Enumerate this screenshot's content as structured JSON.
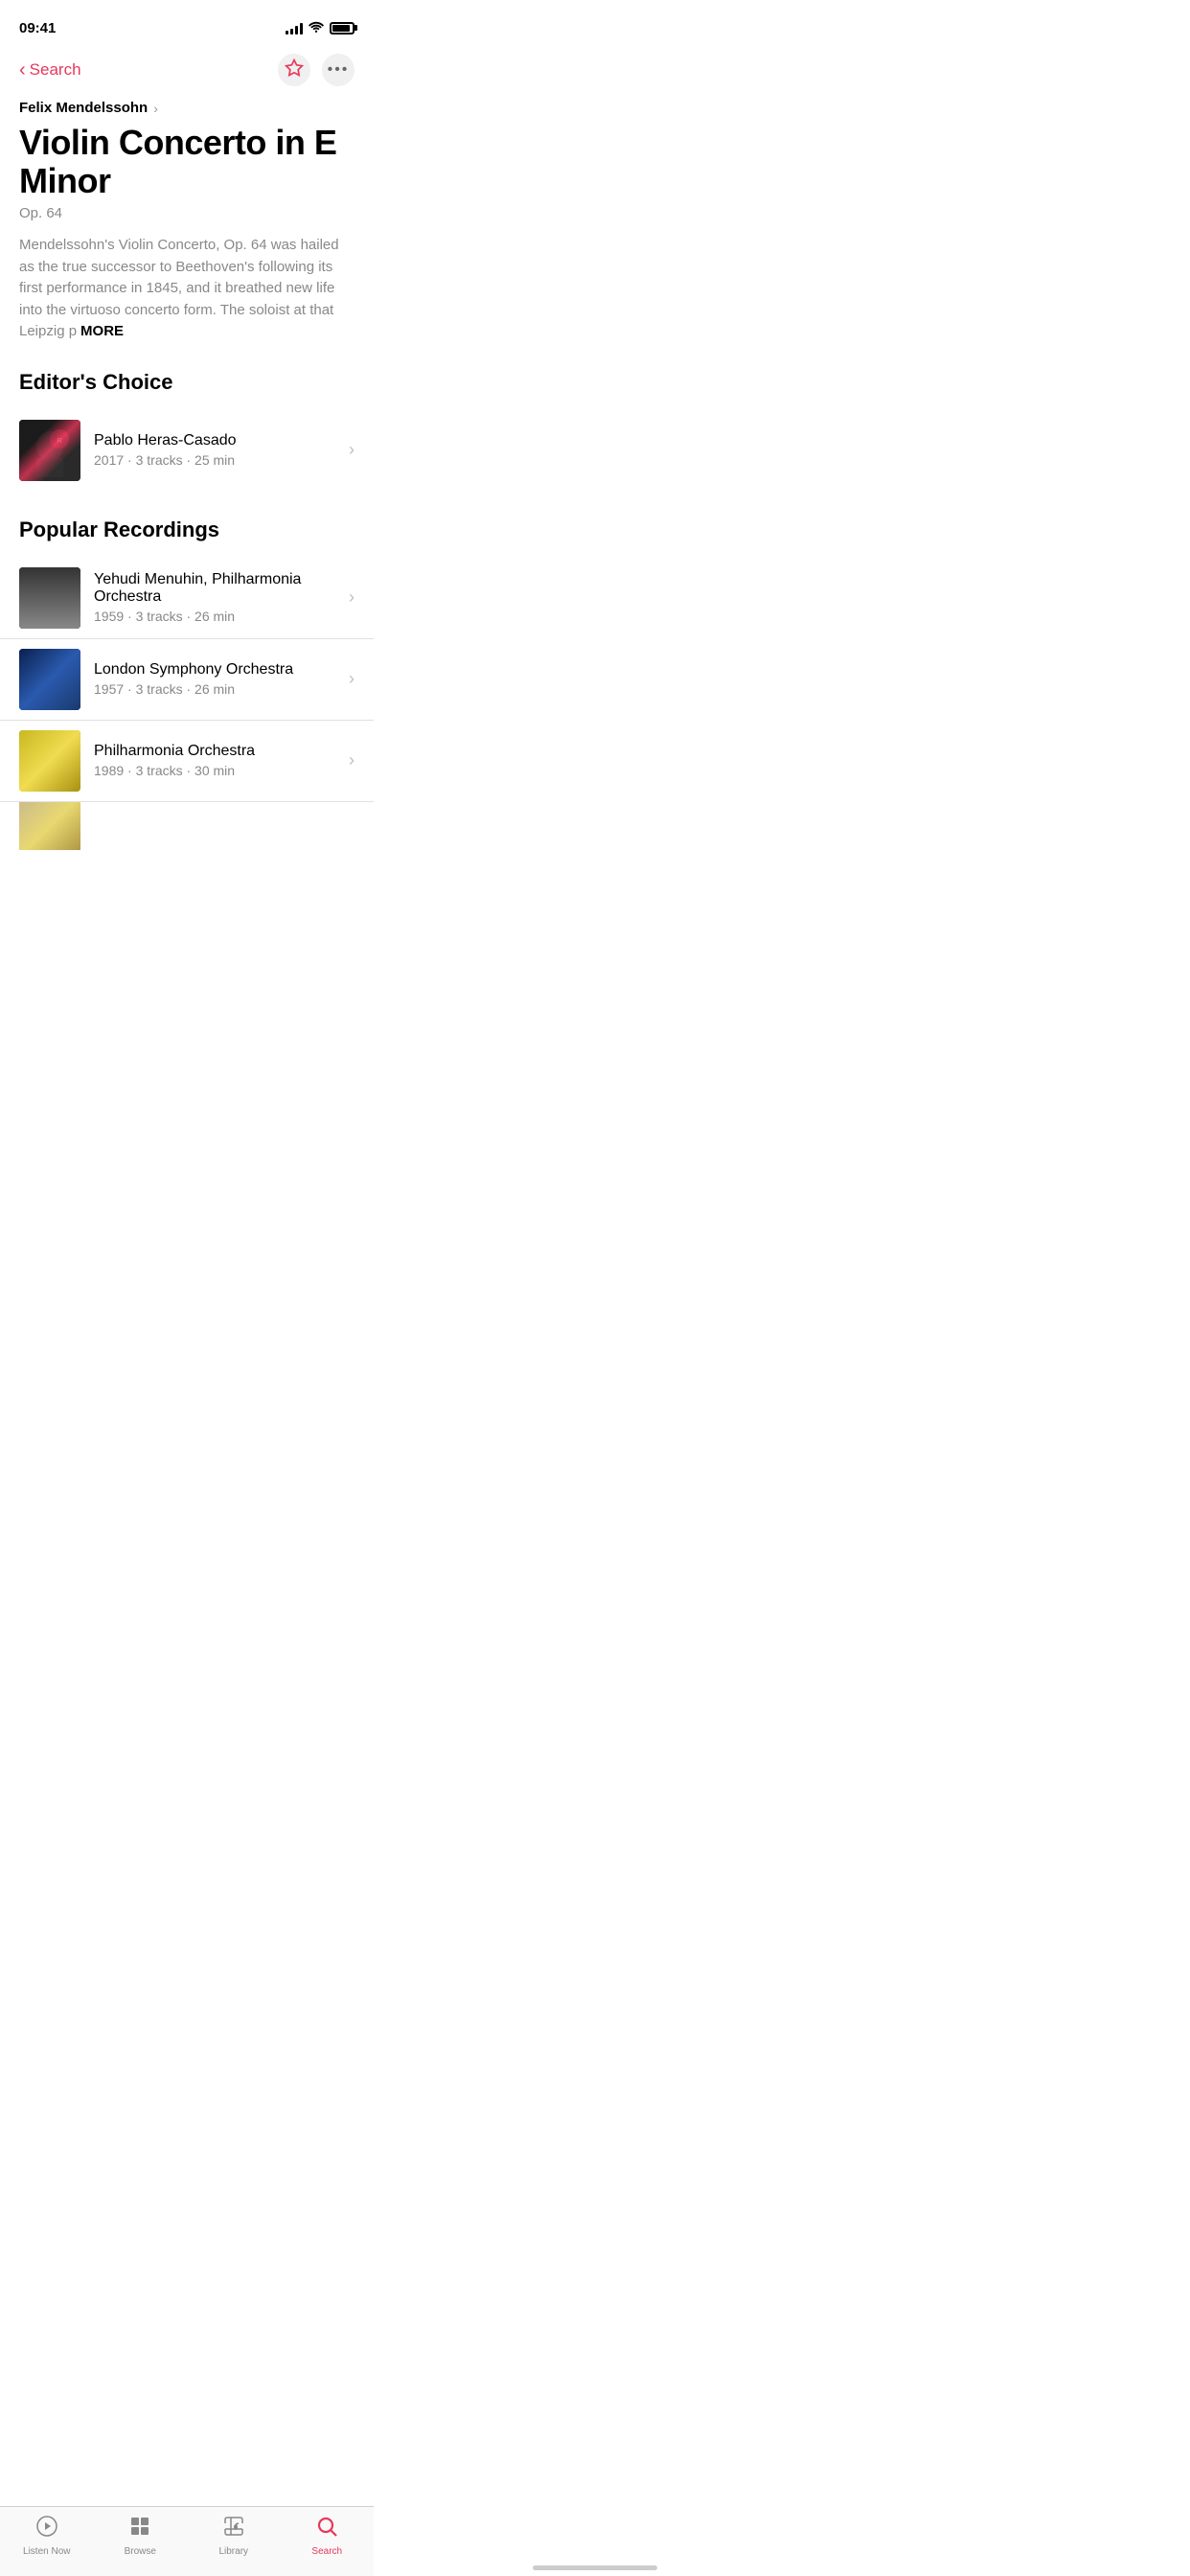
{
  "status_bar": {
    "time": "09:41",
    "signal_bars": 4,
    "wifi": true,
    "battery_full": true
  },
  "nav": {
    "back_label": "Search",
    "favorite_icon": "star",
    "more_icon": "ellipsis"
  },
  "breadcrumb": {
    "artist": "Felix Mendelssohn",
    "chevron": "›"
  },
  "work": {
    "title": "Violin Concerto in E Minor",
    "opus": "Op. 64",
    "description": "Mendelssohn's Violin Concerto, Op. 64 was hailed as the true successor to Beethoven's following its first performance in 1845, and it breathed new life into the virtuoso concerto form. The soloist at that Leipzig p",
    "more_label": "MORE"
  },
  "editors_choice": {
    "section_title": "Editor's Choice",
    "items": [
      {
        "artist": "Pablo Heras-Casado",
        "year": "2017",
        "tracks": "3 tracks",
        "duration": "25 min",
        "subtitle": "2017 · 3 tracks · 25 min"
      }
    ]
  },
  "popular_recordings": {
    "section_title": "Popular Recordings",
    "items": [
      {
        "artist": "Yehudi Menuhin, Philharmonia Orchestra",
        "subtitle": "1959 · 3 tracks · 26 min"
      },
      {
        "artist": "London Symphony Orchestra",
        "subtitle": "1957 · 3 tracks · 26 min"
      },
      {
        "artist": "Philharmonia Orchestra",
        "subtitle": "1989 · 3 tracks · 30 min"
      }
    ]
  },
  "tab_bar": {
    "items": [
      {
        "label": "Listen Now",
        "icon": "▶"
      },
      {
        "label": "Browse",
        "icon": "⊞"
      },
      {
        "label": "Library",
        "icon": "♩"
      },
      {
        "label": "Search",
        "icon": "⌕",
        "active": true
      }
    ]
  }
}
